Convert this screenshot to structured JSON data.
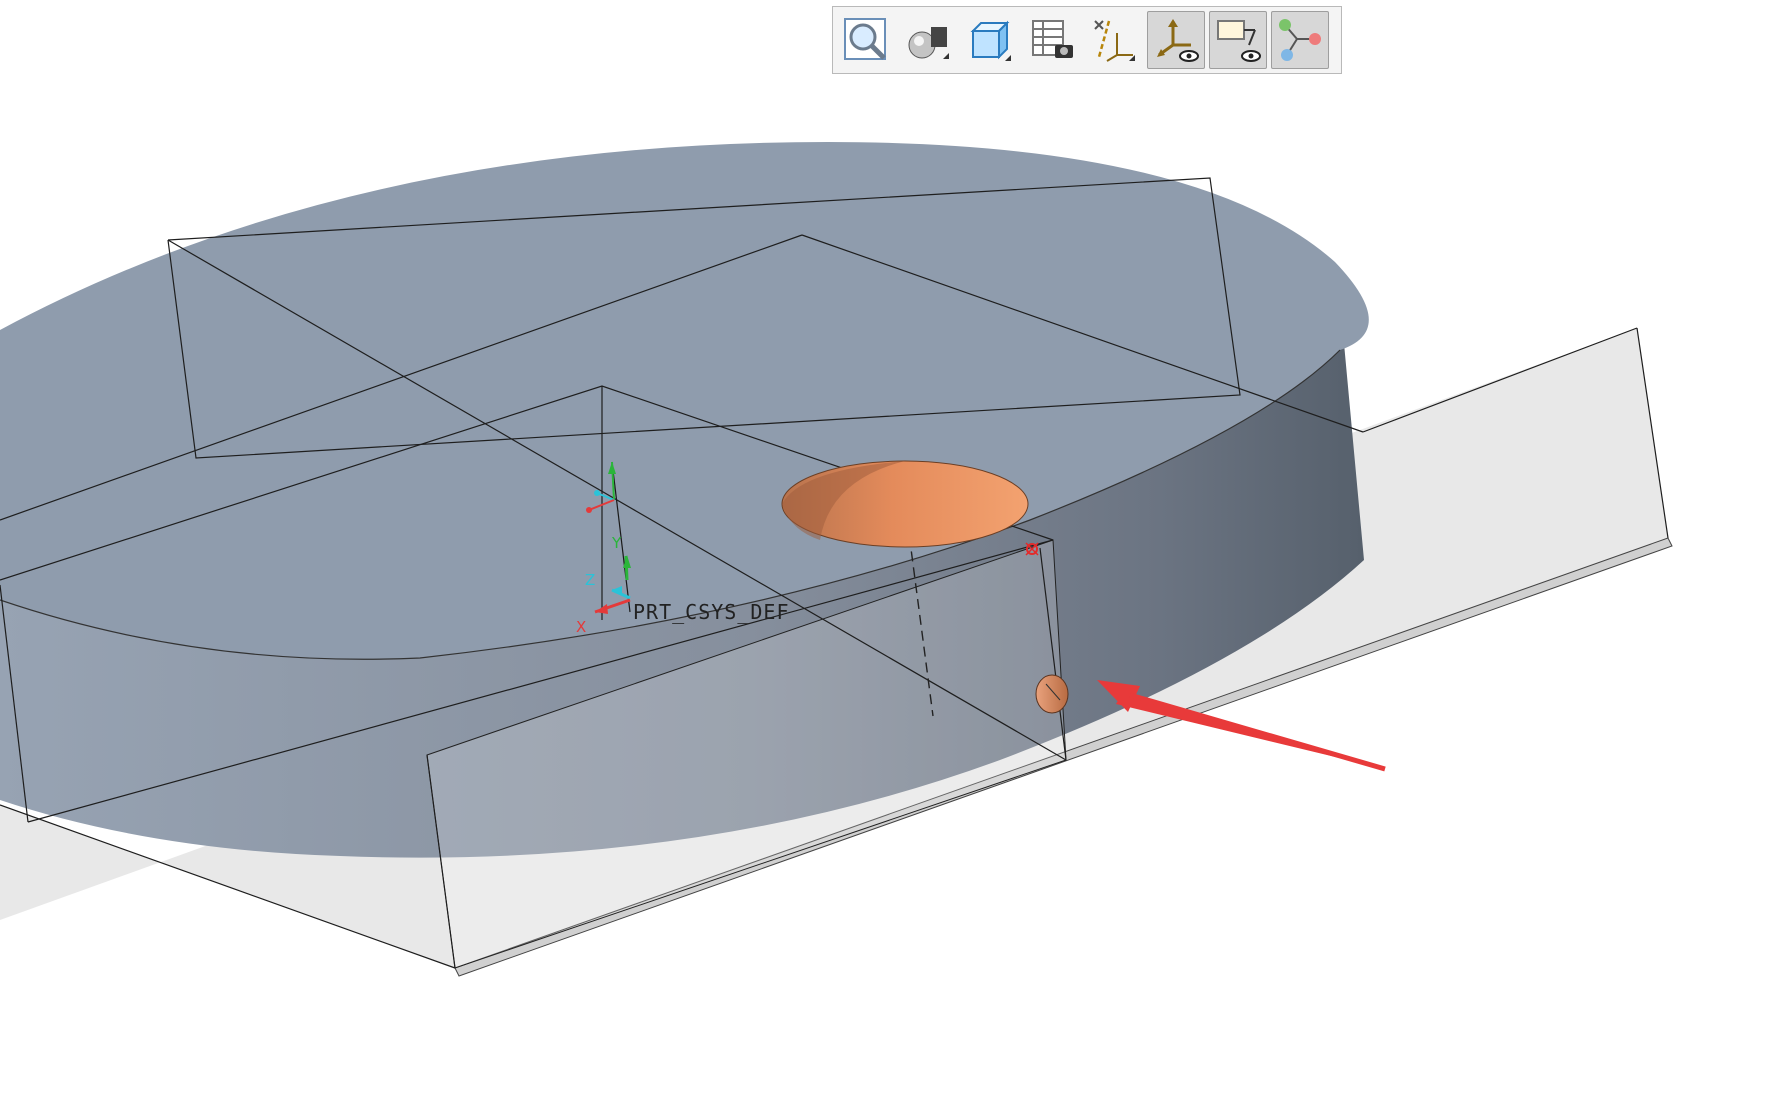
{
  "toolbar": {
    "buttons": [
      {
        "icon": "zoom-refit-icon",
        "active": false
      },
      {
        "icon": "display-style-icon",
        "active": false
      },
      {
        "icon": "saved-orientations-icon",
        "active": false
      },
      {
        "icon": "view-manager-icon",
        "active": false
      },
      {
        "icon": "datum-display-filters-icon",
        "active": false
      },
      {
        "icon": "csys-display-icon",
        "active": true
      },
      {
        "icon": "annotation-display-icon",
        "active": true
      },
      {
        "icon": "spin-center-icon",
        "active": true
      }
    ]
  },
  "model": {
    "csys_label": "PRT_CSYS_DEF",
    "axis_letters": {
      "x": "X",
      "y": "Y",
      "z": "Z"
    }
  },
  "colors": {
    "body_top": "#8f9cad",
    "body_side": "#6e7887",
    "hole": "#e38c5c",
    "datum_plane_fill": "#e2e2e2",
    "arrow": "#e83a3a",
    "axis_x": "#e43a3a",
    "axis_y": "#2ab53a",
    "axis_z": "#2ac3d8"
  }
}
